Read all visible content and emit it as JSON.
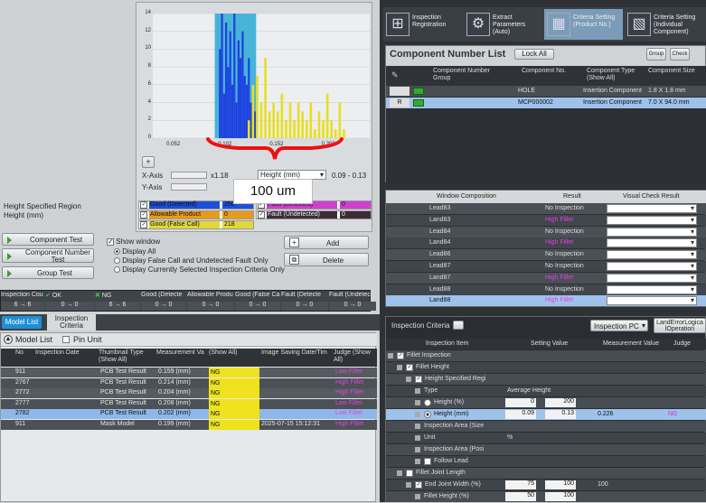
{
  "histogram": {
    "y_ticks": [
      "14",
      "12",
      "10",
      "8",
      "6",
      "4",
      "2",
      "0"
    ],
    "x_ticks": [
      "0.052",
      "0.102",
      "0.152",
      "0.202"
    ],
    "x_axis_label": "X-Axis",
    "y_axis_label": "Y-Axis",
    "x_scale": "x1.18",
    "axis_select": "Height (mm)",
    "range": "0.09 - 0.13",
    "annotation": "100 um",
    "legend": [
      {
        "label": "Good (Detected)",
        "value": "250",
        "color": "#1f4fd8"
      },
      {
        "label": "Allowable Product",
        "value": "0",
        "color": "#e89a1a"
      },
      {
        "label": "Good (False Call)",
        "value": "218",
        "color": "#e0d83a"
      },
      {
        "label": "Fault (Detected)",
        "value": "0",
        "color": "#d040d0"
      },
      {
        "label": "Fault (Undetected)",
        "value": "0",
        "color": "#3a2e34"
      }
    ]
  },
  "chart_data": {
    "type": "bar",
    "xlabel": "X-Axis",
    "ylabel": "Y-Axis",
    "xlim": [
      0.03,
      0.24
    ],
    "ylim": [
      0,
      14
    ],
    "series": [
      {
        "name": "Good (Detected)",
        "color": "#1f40e0",
        "x": [
          0.095,
          0.097,
          0.099,
          0.101,
          0.103,
          0.105,
          0.107,
          0.109,
          0.111,
          0.113,
          0.115,
          0.117,
          0.119,
          0.121,
          0.123,
          0.125,
          0.127,
          0.129
        ],
        "values": [
          10,
          14,
          5,
          13,
          8,
          12,
          6,
          14,
          4,
          11,
          9,
          12,
          7,
          6,
          9,
          4,
          6,
          3
        ]
      },
      {
        "name": "Good (False Call)",
        "color": "#e8df20",
        "x": [
          0.123,
          0.127,
          0.131,
          0.135,
          0.139,
          0.143,
          0.147,
          0.151,
          0.155,
          0.159,
          0.163,
          0.167,
          0.171,
          0.175,
          0.179,
          0.183,
          0.187,
          0.191,
          0.195,
          0.199,
          0.203,
          0.207,
          0.211,
          0.215
        ],
        "values": [
          2,
          6,
          7,
          4,
          9,
          3,
          4,
          3,
          5,
          2,
          4,
          2,
          4,
          3,
          2,
          4,
          1,
          3,
          2,
          5,
          2,
          1,
          4,
          1
        ]
      }
    ]
  },
  "left": {
    "height_region": "Height Specified Region",
    "height_unit": "Height (mm)",
    "buttons": {
      "component_test": "Component Test",
      "component_number_test": "Component Number Test",
      "group_test": "Group Test",
      "add": "Add",
      "delete": "Delete"
    },
    "show_window": "Show window",
    "radios": [
      "Display All",
      "Display False Call and Undetected Fault Only",
      "Display Currently Selected Inspection Criteria Only"
    ]
  },
  "counts": {
    "headers": [
      "Inspection Cou",
      "OK",
      "NG",
      "Good (Detecte",
      "Allowable Produ",
      "Good (False Ca",
      "Fault (Detecte",
      "Fault (Undetec"
    ],
    "values": [
      "6 → 6",
      "0 → 0",
      "6 → 6",
      "0 → 0",
      "0 → 0",
      "0 → 0",
      "0 → 0",
      "0 → 0"
    ]
  },
  "model": {
    "tabs": [
      "Model List",
      "Inspection Criteria"
    ],
    "title": "Model List",
    "pin": "Pin Unit",
    "columns": [
      "No",
      "Inspection Date",
      "Thumbnail Type (Show All)",
      "Measurement Va",
      "(Show All)",
      "Image Saving Date/Tim",
      "Judge (Show All)"
    ],
    "rows": [
      {
        "no": "911",
        "type": "PCB Test Result",
        "meas": "0.159 (mm)",
        "ng": "NG",
        "date": "",
        "judge": "Low Fillet",
        "sel": false
      },
      {
        "no": "2767",
        "type": "PCB Test Result",
        "meas": "0.214 (mm)",
        "ng": "NG",
        "date": "",
        "judge": "High Fillet",
        "sel": false
      },
      {
        "no": "2772",
        "type": "PCB Test Result",
        "meas": "0.204 (mm)",
        "ng": "NG",
        "date": "",
        "judge": "High Fillet",
        "sel": false
      },
      {
        "no": "2777",
        "type": "PCB Test Result",
        "meas": "0.208 (mm)",
        "ng": "NG",
        "date": "",
        "judge": "Low Fillet",
        "sel": false
      },
      {
        "no": "2782",
        "type": "PCB Test Result",
        "meas": "0.202 (mm)",
        "ng": "NG",
        "date": "",
        "judge": "Low Fillet",
        "sel": true
      },
      {
        "no": "911",
        "type": "Mask Model",
        "meas": "0.199 (mm)",
        "ng": "NG",
        "date": "2025-07-15 15:12:31",
        "judge": "High Fillet",
        "sel": false
      }
    ]
  },
  "toolbar": [
    {
      "label": "Inspection Registration"
    },
    {
      "label": "Extract Parameters (Auto)"
    },
    {
      "label": "Criteria Setting (Product No.)",
      "active": true
    },
    {
      "label": "Criteria Setting (Individual Component)"
    }
  ],
  "component": {
    "title": "Component Number List",
    "lock_all": "Lock All",
    "columns": [
      "Component Number Group",
      "Component No.",
      "Component Type (Show All)",
      "Component Size"
    ],
    "group_btns": [
      "Group",
      "Check"
    ],
    "rows": [
      {
        "no": "HOLE",
        "type": "Insertion Component",
        "size": "1.8 X 1.8 mm",
        "sel": false,
        "r": ""
      },
      {
        "no": "MCP000002",
        "type": "Insertion Component",
        "size": "7.0 X 94.0 mm",
        "sel": true,
        "r": "R"
      }
    ]
  },
  "windows": {
    "columns": [
      "Window Composition",
      "Result",
      "Visual Check Result"
    ],
    "rows": [
      {
        "name": "Lead83",
        "result": "No Inspection",
        "hi": false,
        "sel": false
      },
      {
        "name": "Land83",
        "result": "High Fillet",
        "hi": true,
        "sel": false
      },
      {
        "name": "Lead84",
        "result": "No Inspection",
        "hi": false,
        "sel": false
      },
      {
        "name": "Land84",
        "result": "High Fillet",
        "hi": true,
        "sel": false
      },
      {
        "name": "Lead86",
        "result": "No Inspection",
        "hi": false,
        "sel": false
      },
      {
        "name": "Lead87",
        "result": "No Inspection",
        "hi": false,
        "sel": false
      },
      {
        "name": "Land87",
        "result": "High Fillet",
        "hi": true,
        "sel": false
      },
      {
        "name": "Lead88",
        "result": "No Inspection",
        "hi": false,
        "sel": false
      },
      {
        "name": "Land88",
        "result": "High Fillet",
        "hi": true,
        "sel": true
      }
    ]
  },
  "criteria": {
    "title": "Inspection Criteria",
    "inspection_pc": "Inspection PC",
    "land_error": "LandErrorLogica lOperation",
    "columns": [
      "Inspection Item",
      "Setting Value",
      "Measurement Value",
      "Judge"
    ],
    "rows": [
      {
        "indent": 0,
        "box": "check",
        "label": "Fillet Inspection",
        "v1": "",
        "v2": "",
        "meas": "",
        "judge": ""
      },
      {
        "indent": 1,
        "box": "check",
        "label": "Fillet Height",
        "v1": "",
        "v2": "",
        "meas": "",
        "judge": ""
      },
      {
        "indent": 2,
        "box": "check",
        "label": "Height Specified Regi",
        "v1": "",
        "v2": "",
        "meas": "",
        "judge": ""
      },
      {
        "indent": 3,
        "box": "",
        "label": "Type",
        "v1": "Average Height",
        "v2": "",
        "meas": "",
        "judge": ""
      },
      {
        "indent": 3,
        "box": "radio",
        "label": "Height (%)",
        "v1": "0",
        "v2": "200",
        "meas": "",
        "judge": ""
      },
      {
        "indent": 3,
        "box": "radio",
        "label": "Height (mm)",
        "v1": "0.09",
        "v2": "0.13",
        "meas": "0.226",
        "judge": "NG",
        "sel": true
      },
      {
        "indent": 3,
        "box": "",
        "label": "Inspection Area (Size",
        "v1": "",
        "v2": "",
        "meas": "",
        "judge": ""
      },
      {
        "indent": 3,
        "box": "",
        "label": "Unit",
        "v1": "%",
        "v2": "",
        "meas": "",
        "judge": ""
      },
      {
        "indent": 3,
        "box": "",
        "label": "Inspection Area (Posi",
        "v1": "",
        "v2": "",
        "meas": "",
        "judge": ""
      },
      {
        "indent": 3,
        "box": "uncheck",
        "label": "Follow Lead",
        "v1": "",
        "v2": "",
        "meas": "",
        "judge": ""
      },
      {
        "indent": 1,
        "box": "uncheck",
        "label": "Fillet Joint Length",
        "v1": "",
        "v2": "",
        "meas": "",
        "judge": ""
      },
      {
        "indent": 2,
        "box": "check",
        "label": "End Joint Width (%)",
        "v1": "75",
        "v2": "100",
        "meas": "100",
        "judge": ""
      },
      {
        "indent": 3,
        "box": "",
        "label": "Fillet Height (%)",
        "v1": "50",
        "v2": "100",
        "meas": "",
        "judge": ""
      }
    ]
  }
}
